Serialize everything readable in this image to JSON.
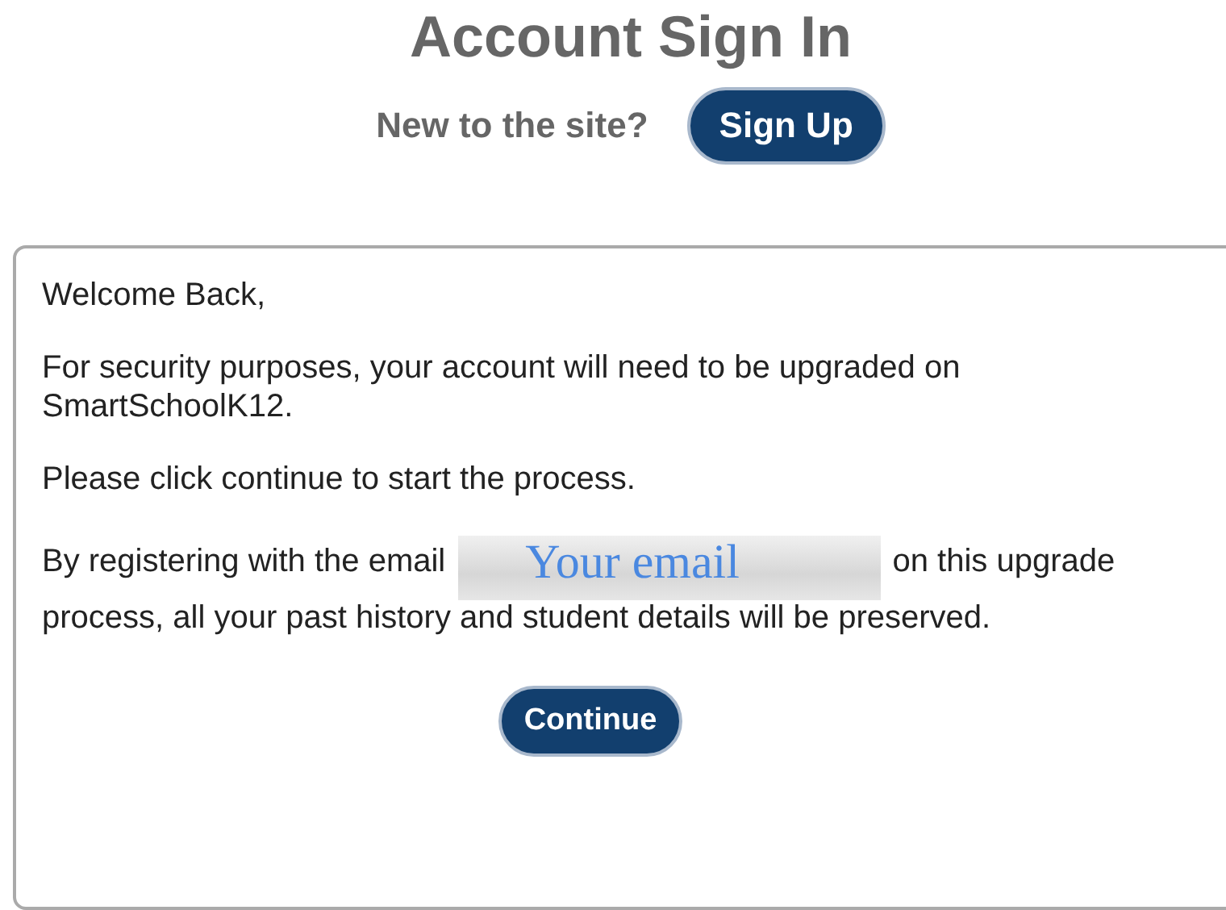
{
  "title": "Account Sign In",
  "signup": {
    "prompt": "New to the site?",
    "button": "Sign Up"
  },
  "message": {
    "greeting": "Welcome Back,",
    "paragraphs": [
      "For security purposes, your account will need to be upgraded on SmartSchoolK12.",
      "Please click continue to start the process."
    ],
    "email_sentence": {
      "before": "By registering with the email",
      "email": "Your email",
      "after": "on this upgrade process, all your past history and student details will be preserved."
    },
    "button": "Continue"
  }
}
